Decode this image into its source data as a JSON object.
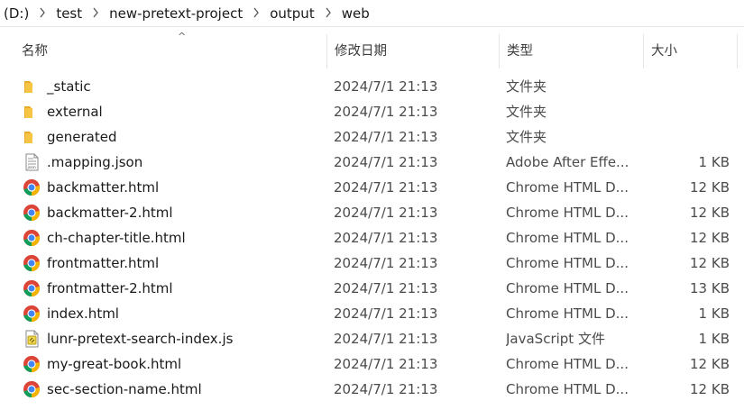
{
  "address_bar": {
    "segments": [
      "(D:)",
      "test",
      "new-pretext-project",
      "output",
      "web"
    ]
  },
  "columns": {
    "name": "名称",
    "modified": "修改日期",
    "type": "类型",
    "size": "大小"
  },
  "files": [
    {
      "name": "_static",
      "modified": "2024/7/1 21:13",
      "type": "文件夹",
      "size": "",
      "icon": "folder-icon"
    },
    {
      "name": "external",
      "modified": "2024/7/1 21:13",
      "type": "文件夹",
      "size": "",
      "icon": "folder-icon"
    },
    {
      "name": "generated",
      "modified": "2024/7/1 21:13",
      "type": "文件夹",
      "size": "",
      "icon": "folder-icon"
    },
    {
      "name": ".mapping.json",
      "modified": "2024/7/1 21:13",
      "type": "Adobe After Effe...",
      "size": "1 KB",
      "icon": "json-file-icon"
    },
    {
      "name": "backmatter.html",
      "modified": "2024/7/1 21:13",
      "type": "Chrome HTML D...",
      "size": "12 KB",
      "icon": "chrome-icon"
    },
    {
      "name": "backmatter-2.html",
      "modified": "2024/7/1 21:13",
      "type": "Chrome HTML D...",
      "size": "12 KB",
      "icon": "chrome-icon"
    },
    {
      "name": "ch-chapter-title.html",
      "modified": "2024/7/1 21:13",
      "type": "Chrome HTML D...",
      "size": "12 KB",
      "icon": "chrome-icon"
    },
    {
      "name": "frontmatter.html",
      "modified": "2024/7/1 21:13",
      "type": "Chrome HTML D...",
      "size": "12 KB",
      "icon": "chrome-icon"
    },
    {
      "name": "frontmatter-2.html",
      "modified": "2024/7/1 21:13",
      "type": "Chrome HTML D...",
      "size": "13 KB",
      "icon": "chrome-icon"
    },
    {
      "name": "index.html",
      "modified": "2024/7/1 21:13",
      "type": "Chrome HTML D...",
      "size": "1 KB",
      "icon": "chrome-icon"
    },
    {
      "name": "lunr-pretext-search-index.js",
      "modified": "2024/7/1 21:13",
      "type": "JavaScript 文件",
      "size": "1 KB",
      "icon": "js-file-icon"
    },
    {
      "name": "my-great-book.html",
      "modified": "2024/7/1 21:13",
      "type": "Chrome HTML D...",
      "size": "12 KB",
      "icon": "chrome-icon"
    },
    {
      "name": "sec-section-name.html",
      "modified": "2024/7/1 21:13",
      "type": "Chrome HTML D...",
      "size": "12 KB",
      "icon": "chrome-icon"
    }
  ],
  "colors": {
    "folder": "#f5c543",
    "chrome_red": "#db4437",
    "chrome_green": "#0f9d58",
    "chrome_yellow": "#f4b400",
    "chrome_blue": "#4285f4"
  }
}
